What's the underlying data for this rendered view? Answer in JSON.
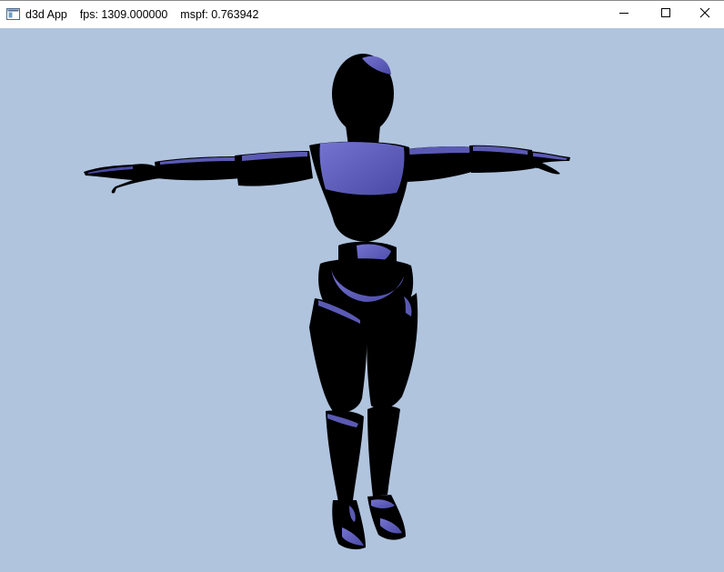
{
  "window": {
    "title": "d3d App    fps: 1309.000000    mspf: 0.763942",
    "icon": "application-window-icon",
    "controls": {
      "minimize": "minimize-icon",
      "maximize": "maximize-icon",
      "close": "close-icon"
    }
  },
  "viewport": {
    "clear_color": "#b0c4de",
    "model": "humanoid-mannequin",
    "model_dark_color": "#000000",
    "model_lit_color": "#5a5ab4"
  }
}
